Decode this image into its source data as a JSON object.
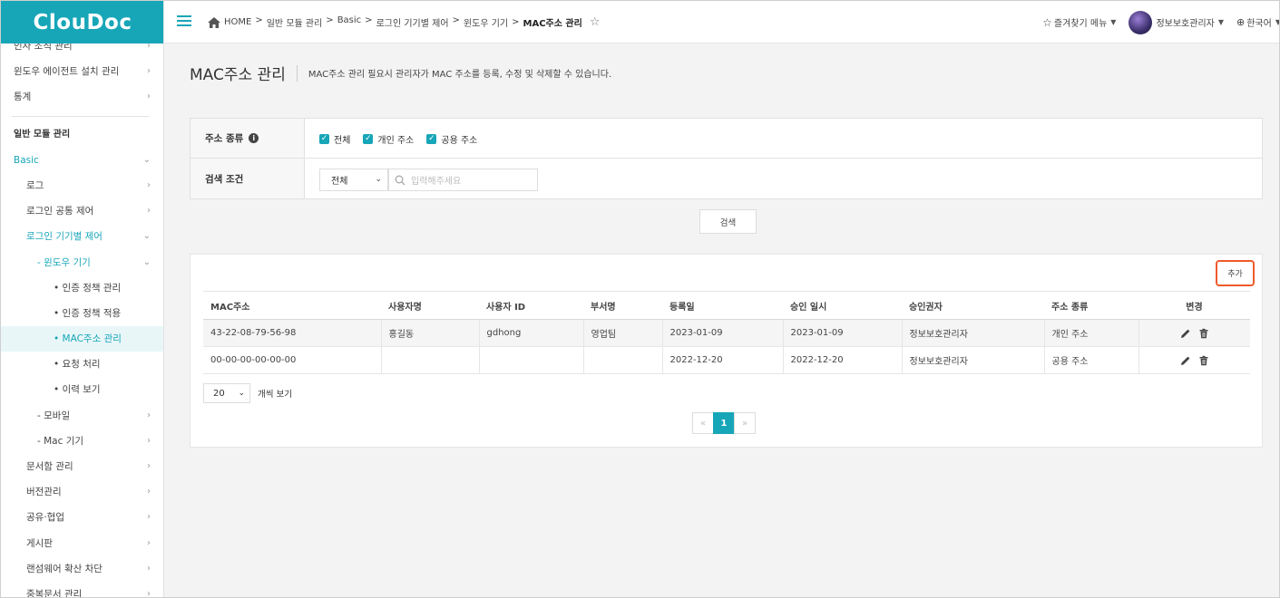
{
  "app": {
    "logo": "ClouDoc"
  },
  "sidebar": {
    "items": [
      {
        "label": "인사 조직 관리",
        "level": "l1",
        "chev": "›"
      },
      {
        "label": "윈도우 에이전트 설치 관리",
        "level": "l1",
        "chev": "›"
      },
      {
        "label": "통계",
        "level": "l1",
        "chev": "›"
      }
    ],
    "section_title": "일반 모듈 관리",
    "items2": [
      {
        "label": "Basic",
        "level": "l1",
        "chev": "⌄",
        "style": "teal"
      },
      {
        "label": "로그",
        "level": "l2",
        "chev": "›"
      },
      {
        "label": "로그인 공통 제어",
        "level": "l2",
        "chev": "›"
      },
      {
        "label": "로그인 기기별 제어",
        "level": "l2",
        "chev": "⌄",
        "style": "teal"
      },
      {
        "label": "- 윈도우 기기",
        "level": "l3",
        "chev": "⌄",
        "style": "teal"
      },
      {
        "label": "• 인증 정책 관리",
        "level": "l4",
        "chev": ""
      },
      {
        "label": "• 인증 정책 적용",
        "level": "l4",
        "chev": ""
      },
      {
        "label": "• MAC주소 관리",
        "level": "l4",
        "chev": "",
        "style": "active"
      },
      {
        "label": "• 요청 처리",
        "level": "l4",
        "chev": ""
      },
      {
        "label": "• 이력 보기",
        "level": "l4",
        "chev": ""
      },
      {
        "label": "- 모바일",
        "level": "l3",
        "chev": "›"
      },
      {
        "label": "- Mac 기기",
        "level": "l3",
        "chev": "›"
      },
      {
        "label": "문서함 관리",
        "level": "l2",
        "chev": "›"
      },
      {
        "label": "버전관리",
        "level": "l2",
        "chev": "›"
      },
      {
        "label": "공유·협업",
        "level": "l2",
        "chev": "›"
      },
      {
        "label": "게시판",
        "level": "l2",
        "chev": "›"
      },
      {
        "label": "랜섬웨어 확산 차단",
        "level": "l2",
        "chev": "›"
      },
      {
        "label": "중복문서 관리",
        "level": "l2",
        "chev": "›"
      }
    ]
  },
  "breadcrumb": {
    "home": "HOME",
    "sep": ">",
    "path": [
      "일반 모듈 관리",
      "Basic",
      "로그인 기기별 제어",
      "윈도우 기기"
    ],
    "current": "MAC주소 관리"
  },
  "topbar": {
    "favorites": "즐겨찾기 메뉴",
    "user": "정보보호관리자",
    "language": "한국어"
  },
  "page": {
    "title": "MAC주소 관리",
    "description": "MAC주소 관리 필요시 관리자가 MAC 주소를 등록, 수정 및 삭제할 수 있습니다."
  },
  "filter": {
    "type_label": "주소 종류",
    "checkboxes": [
      "전체",
      "개인 주소",
      "공용 주소"
    ],
    "cond_label": "검색 조건",
    "select_value": "전체",
    "search_placeholder": "입력해주세요"
  },
  "search_button": "검색",
  "add_button": "추가",
  "table": {
    "headers": [
      "MAC주소",
      "사용자명",
      "사용자 ID",
      "부서명",
      "등록일",
      "승인 일시",
      "승인권자",
      "주소 종류",
      "변경"
    ],
    "rows": [
      [
        "43-22-08-79-56-98",
        "홍길동",
        "gdhong",
        "영업팀",
        "2023-01-09",
        "2023-01-09",
        "정보보호관리자",
        "개인 주소"
      ],
      [
        "00-00-00-00-00-00",
        "",
        "",
        "",
        "2022-12-20",
        "2022-12-20",
        "정보보호관리자",
        "공용 주소"
      ]
    ]
  },
  "pagination": {
    "page_size": "20",
    "page_size_label": "개씩 보기",
    "prev": "«",
    "current": "1",
    "next": "»"
  },
  "colors": {
    "accent": "#17a6b8",
    "highlight": "#ee5a2a"
  }
}
